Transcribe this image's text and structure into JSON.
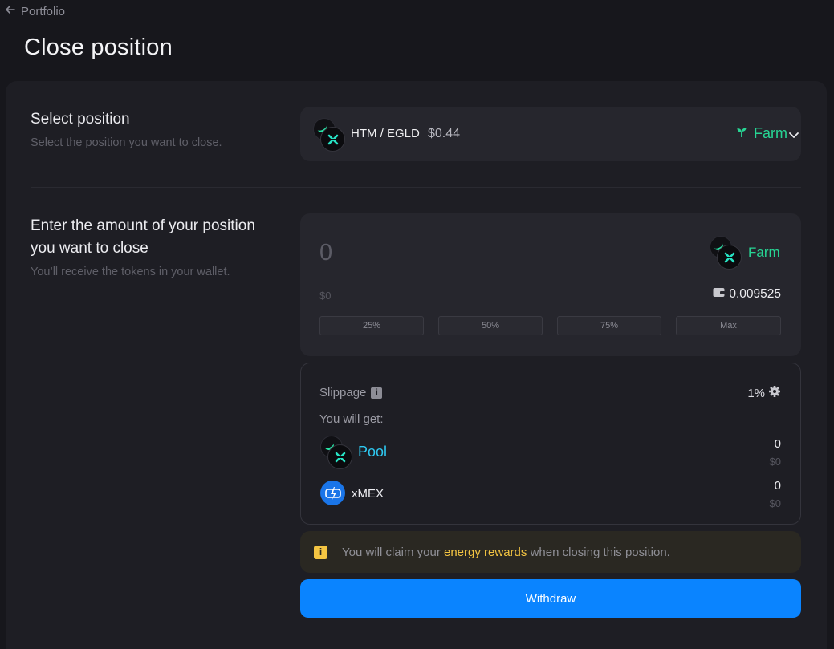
{
  "nav": {
    "back_label": "Portfolio"
  },
  "page": {
    "title": "Close position"
  },
  "select_section": {
    "title": "Select position",
    "subtitle": "Select the position you want to close.",
    "selected": {
      "pair": "HTM / EGLD",
      "price": "$0.44",
      "type": "Farm"
    }
  },
  "amount_section": {
    "title": "Enter the amount of your position you want to close",
    "subtitle": "You’ll receive the tokens in your wallet.",
    "input_placeholder": "0",
    "usd_value": "$0",
    "token_label": "Farm",
    "balance": "0.009525",
    "percent_buttons": [
      "25%",
      "50%",
      "75%",
      "Max"
    ]
  },
  "result": {
    "slippage_label": "Slippage",
    "slippage_value": "1%",
    "you_get_label": "You will get:",
    "items": [
      {
        "label": "Pool",
        "amount": "0",
        "usd": "$0",
        "color": "#2ec8f0"
      },
      {
        "label": "xMEX",
        "amount": "0",
        "usd": "$0",
        "color": "#ececf0"
      }
    ]
  },
  "notice": {
    "prefix": "You will claim your",
    "highlight": "energy rewards",
    "suffix": "when closing this position."
  },
  "actions": {
    "withdraw_label": "Withdraw"
  },
  "colors": {
    "accent_blue": "#0a84ff",
    "farm_green": "#27d594",
    "pool_cyan": "#2ec8f0",
    "warning_yellow": "#f4c542",
    "background": "#17171c",
    "card": "#1e1e24"
  },
  "icons": [
    "arrow-left-icon",
    "sprout-icon",
    "chevron-down-icon",
    "wallet-icon",
    "info-icon",
    "gear-icon",
    "lightning-icon",
    "mex-x-icon"
  ]
}
